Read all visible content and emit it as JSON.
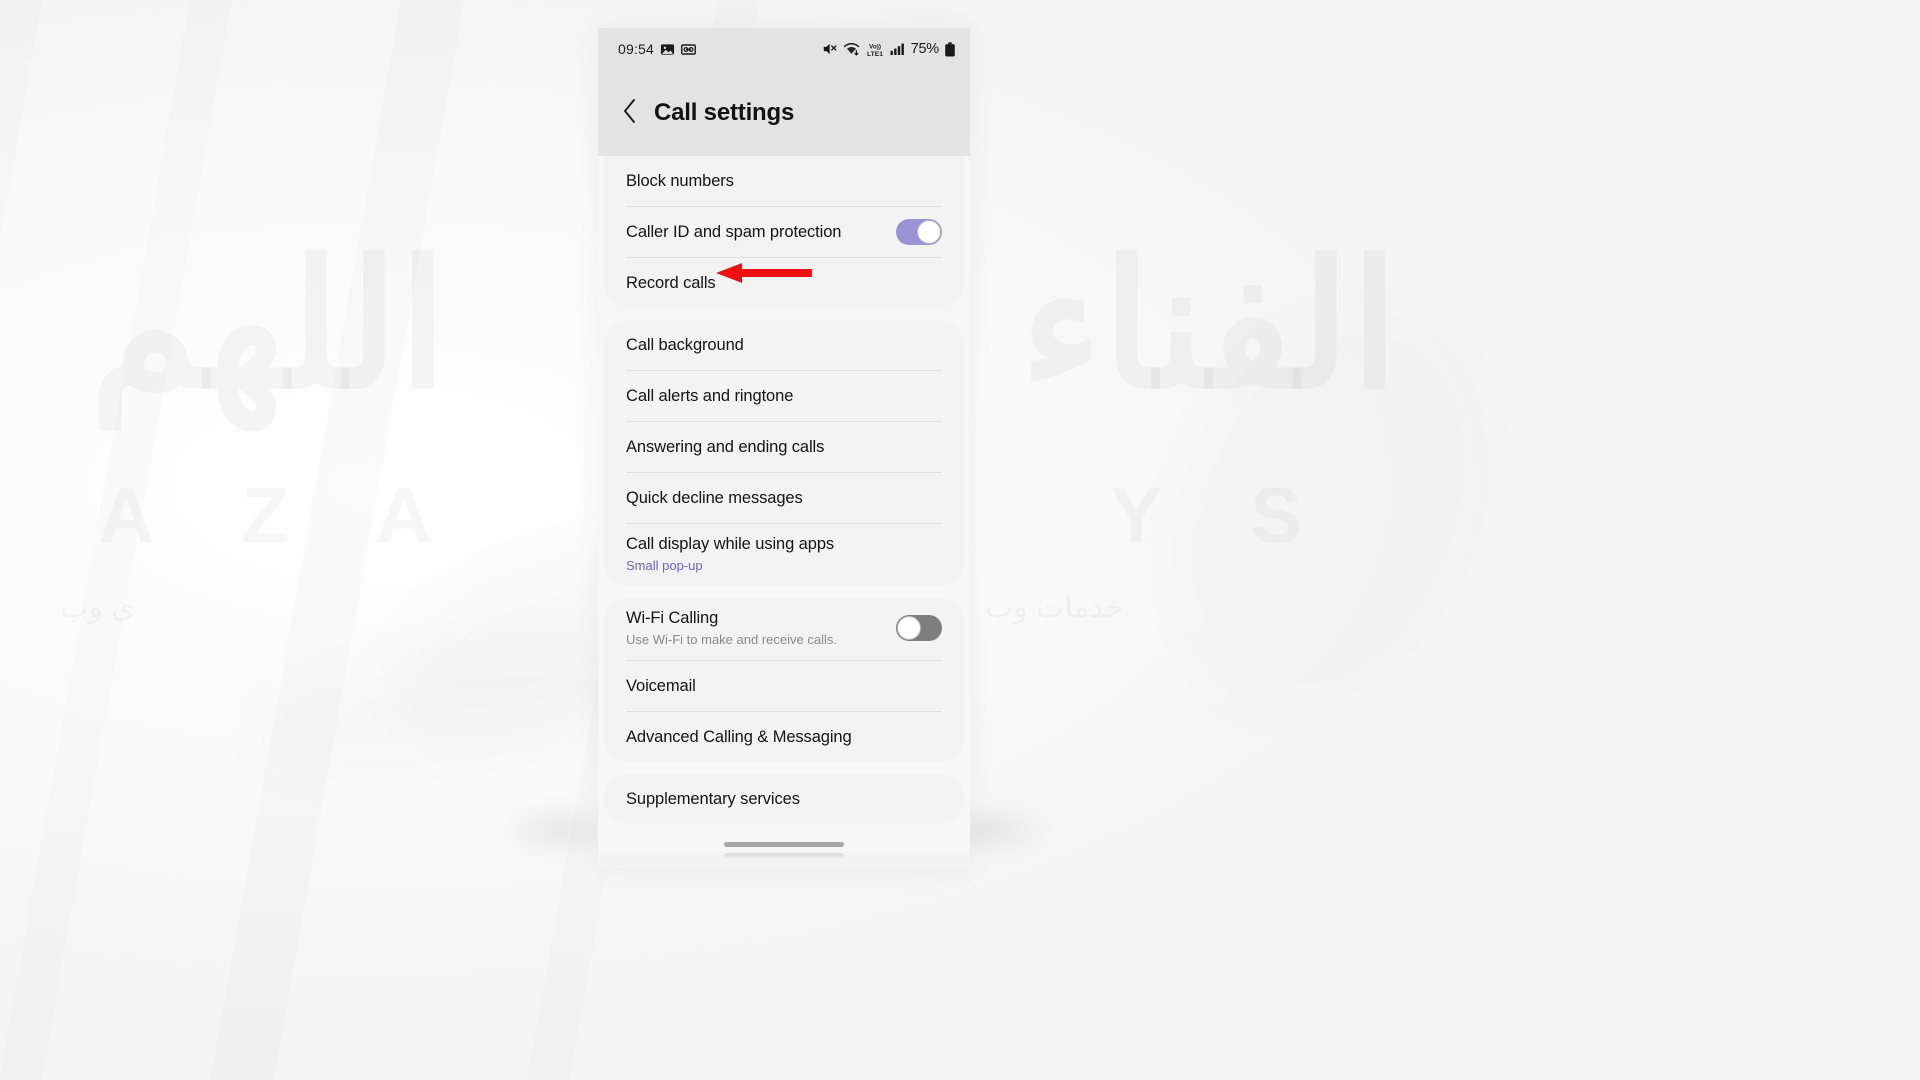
{
  "page": {
    "background_watermark": {
      "left_main": "اللهم",
      "left_sub": "A  Z  A",
      "right_main": "الفناء",
      "right_sub": "Y   S",
      "tag_left": "ی وب",
      "tag_right": "خدمات وب"
    }
  },
  "phone": {
    "status_bar": {
      "time": "09:54",
      "left_icons": [
        "photo-icon",
        "voice-recorder-icon"
      ],
      "right_icons": [
        "mute-icon",
        "wifi-download-icon",
        "volte-icon",
        "signal-bars-icon"
      ],
      "volte_top": "Vo))",
      "volte_bottom": "LTE1",
      "battery_percent": "75%",
      "battery_icon": "battery-full-icon"
    },
    "title_bar": {
      "back_icon": "chevron-left-icon",
      "title": "Call settings"
    },
    "sections": [
      {
        "name": "blocking-section",
        "rows": [
          {
            "title": "Block numbers",
            "subtitle": null,
            "control": null
          },
          {
            "title": "Caller ID and spam protection",
            "subtitle": null,
            "control": "toggle",
            "toggle_state": "on"
          },
          {
            "title": "Record calls",
            "subtitle": null,
            "control": null
          }
        ]
      },
      {
        "name": "call-experience-section",
        "rows": [
          {
            "title": "Call background",
            "subtitle": null,
            "control": null
          },
          {
            "title": "Call alerts and ringtone",
            "subtitle": null,
            "control": null
          },
          {
            "title": "Answering and ending calls",
            "subtitle": null,
            "control": null
          },
          {
            "title": "Quick decline messages",
            "subtitle": null,
            "control": null
          },
          {
            "title": "Call display while using apps",
            "subtitle": "Small pop-up",
            "subtitle_accent": true,
            "control": null
          }
        ]
      },
      {
        "name": "network-section",
        "rows": [
          {
            "title": "Wi-Fi Calling",
            "subtitle": "Use Wi-Fi to make and receive calls.",
            "control": "toggle",
            "toggle_state": "off"
          },
          {
            "title": "Voicemail",
            "subtitle": null,
            "control": null
          },
          {
            "title": "Advanced Calling & Messaging",
            "subtitle": null,
            "control": null
          }
        ]
      },
      {
        "name": "supplementary-section",
        "rows": [
          {
            "title": "Supplementary services",
            "subtitle": null,
            "control": null
          }
        ]
      }
    ],
    "home_indicator": "home-indicator-bar"
  },
  "annotation": {
    "arrow": "red-left-arrow",
    "color": "#ee1111",
    "points_at": "Record calls"
  },
  "colors": {
    "toggle_on": "#9a93d6",
    "toggle_off": "#7e7e7e",
    "accent_subtitle": "#6b62c4",
    "status_bar_bg": "#e3e3e3",
    "card_bg": "#f3f3f3",
    "screen_bg": "#f7f7f7",
    "annotation_red": "#ee1111"
  }
}
